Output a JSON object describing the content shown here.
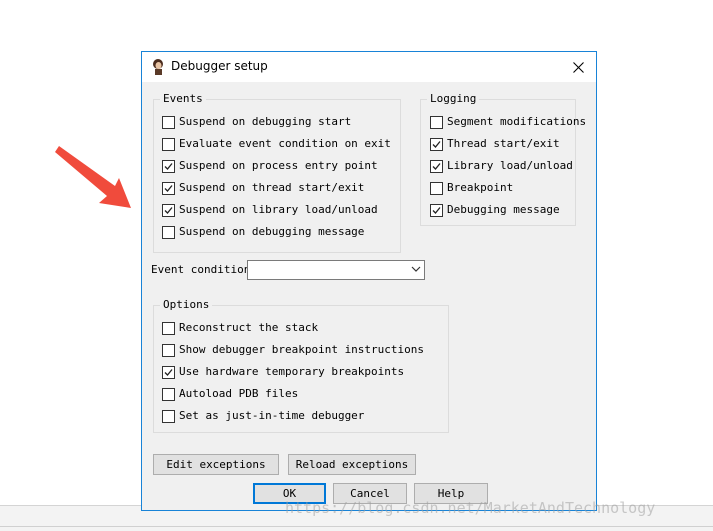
{
  "window": {
    "title": "Debugger setup",
    "icon": "avatar-icon",
    "close": "close-icon"
  },
  "events": {
    "title": "Events",
    "items": [
      {
        "label": "Suspend on debugging start",
        "checked": false
      },
      {
        "label": "Evaluate event condition on exit",
        "checked": false
      },
      {
        "label": "Suspend on process entry point",
        "checked": true
      },
      {
        "label": "Suspend on thread start/exit",
        "checked": true
      },
      {
        "label": "Suspend on library load/unload",
        "checked": true
      },
      {
        "label": "Suspend on debugging message",
        "checked": false
      }
    ]
  },
  "logging": {
    "title": "Logging",
    "items": [
      {
        "label": "Segment modifications",
        "checked": false
      },
      {
        "label": "Thread start/exit",
        "checked": true
      },
      {
        "label": "Library load/unload",
        "checked": true
      },
      {
        "label": "Breakpoint",
        "checked": false
      },
      {
        "label": "Debugging message",
        "checked": true
      }
    ]
  },
  "event_condition": {
    "label": "Event condition",
    "value": ""
  },
  "options": {
    "title": "Options",
    "items": [
      {
        "label": "Reconstruct the stack",
        "checked": false
      },
      {
        "label": "Show debugger breakpoint instructions",
        "checked": false
      },
      {
        "label": "Use hardware temporary breakpoints",
        "checked": true
      },
      {
        "label": "Autoload PDB files",
        "checked": false
      },
      {
        "label": "Set as just-in-time debugger",
        "checked": false
      }
    ]
  },
  "buttons": {
    "edit_exceptions": "Edit exceptions",
    "reload_exceptions": "Reload exceptions",
    "ok": "OK",
    "cancel": "Cancel",
    "help": "Help"
  },
  "watermark": "https://blog.csdn.net/MarketAndTechnology",
  "colors": {
    "accent": "#1883d7",
    "arrow": "#f04b3c",
    "dialog_bg": "#f0f0f0"
  }
}
